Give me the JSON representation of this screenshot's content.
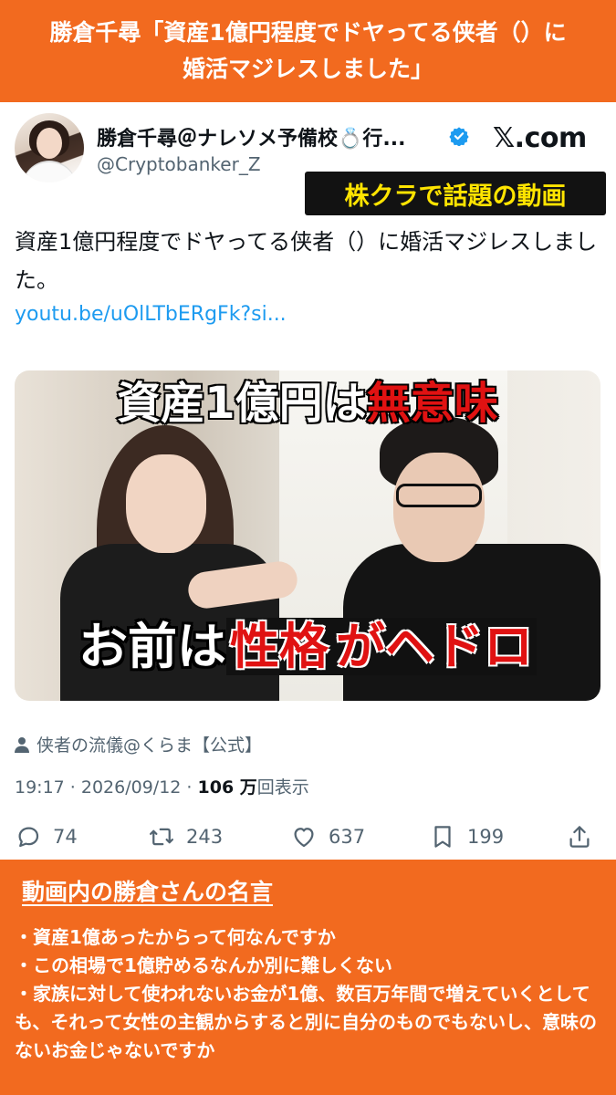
{
  "banner": {
    "line1": "勝倉千尋「資産1億円程度でドヤってる侠者（）に",
    "line2": "婚活マジレスしました」"
  },
  "tweet": {
    "display_name": "勝倉千尋＠ナレソメ予備校💍行...",
    "handle": "@Cryptobanker_Z",
    "site_logo": "𝕏.com",
    "badge": "株クラで話題の動画",
    "text": "資産1億円程度でドヤってる侠者（）に婚活マジレスしました。",
    "link": "youtu.be/uOlLTbERgFk?si...",
    "video": {
      "top_caption_white": "資産1億円は",
      "top_caption_red": "無意味",
      "bottom_caption_white": "お前は",
      "bottom_caption_red": "性格",
      "bottom_caption_white2": "がヘドロ"
    },
    "source": "侠者の流儀@くらま【公式】",
    "time": "19:17 · 2026/09/12 · ",
    "views_count": "106 万",
    "views_label": "回表示",
    "actions": {
      "replies": "74",
      "retweets": "243",
      "likes": "637",
      "bookmarks": "199"
    },
    "icons": [
      "verified-badge-icon",
      "person-icon",
      "reply-icon",
      "retweet-icon",
      "like-icon",
      "bookmark-icon",
      "share-icon"
    ],
    "colors": {
      "accent": "#1d9bf0",
      "secondary_text": "#536471"
    }
  },
  "panel": {
    "title": "動画内の勝倉さんの名言",
    "items": [
      "・資産1億あったからって何なんですか",
      "・この相場で1億貯めるなんか別に難しくない",
      "・家族に対して使われないお金が1億、数百万年間で増えていくとしても、それって女性の主観からすると別に自分のものでもないし、意味のないお金じゃないですか"
    ],
    "color": "#f26a1f"
  }
}
